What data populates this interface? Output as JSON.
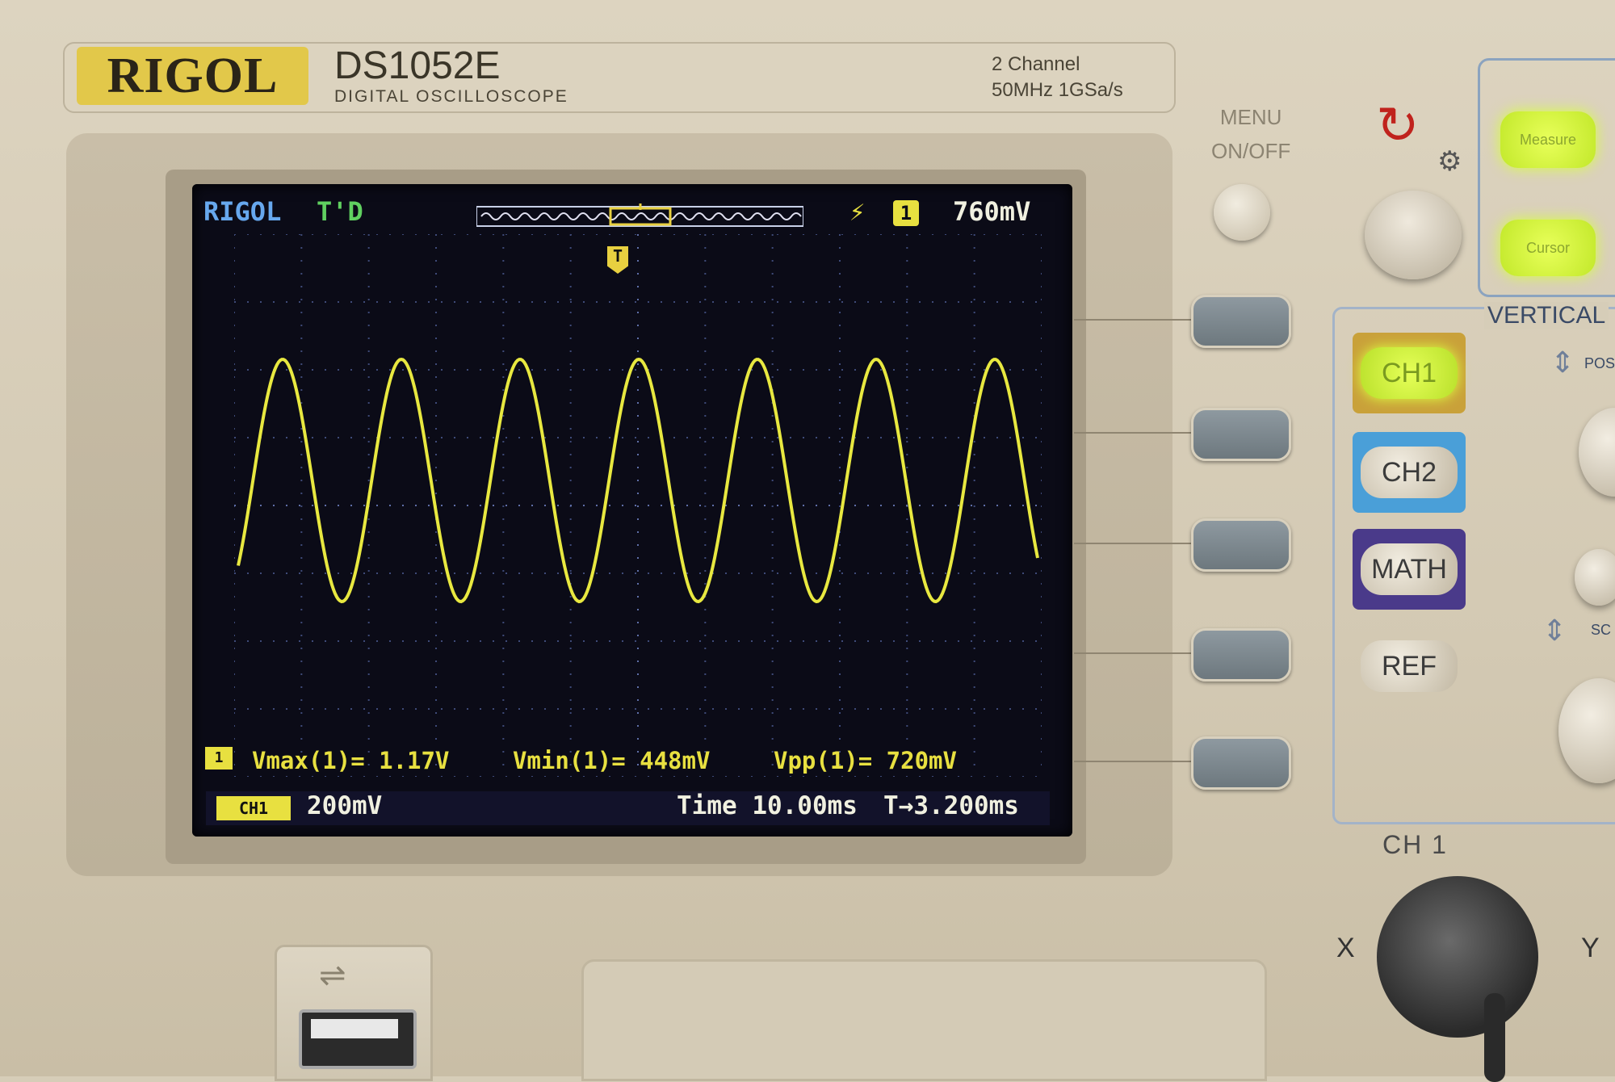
{
  "device": {
    "brand": "RIGOL",
    "model": "DS1052E",
    "model_subtitle": "DIGITAL OSCILLOSCOPE",
    "spec_line1": "2 Channel",
    "spec_line2": "50MHz 1GSa/s"
  },
  "display": {
    "brand": "RIGOL",
    "status": "T'D",
    "trigger_slope_icon": "rising-edge-icon",
    "trigger_channel": "1",
    "trigger_level": "760mV",
    "trigger_marker": "T",
    "ch1_marker": "1",
    "measurements": [
      {
        "label": "Vmax(1)= 1.17V"
      },
      {
        "label": "Vmin(1)= 448mV"
      },
      {
        "label": "Vpp(1)= 720mV"
      }
    ],
    "ch_scale": "200mV",
    "time": "Time 10.00ms",
    "trigger_delay": "T→3.200ms"
  },
  "waveform": {
    "type": "sine",
    "color": "#e8e840",
    "cycles": 6.75,
    "vmax": 1.17,
    "vmin": 0.448
  },
  "controls": {
    "menu_label_line1": "MENU",
    "menu_label_line2": "ON/OFF",
    "measure_label": "Measure",
    "cursor_label": "Cursor",
    "vertical_title": "VERTICAL",
    "pos_label": "POS",
    "scale_label": "SC",
    "channels": [
      "CH1",
      "CH2",
      "MATH",
      "REF"
    ],
    "input_label": "CH 1",
    "x_label": "X",
    "y_label": "Y"
  }
}
